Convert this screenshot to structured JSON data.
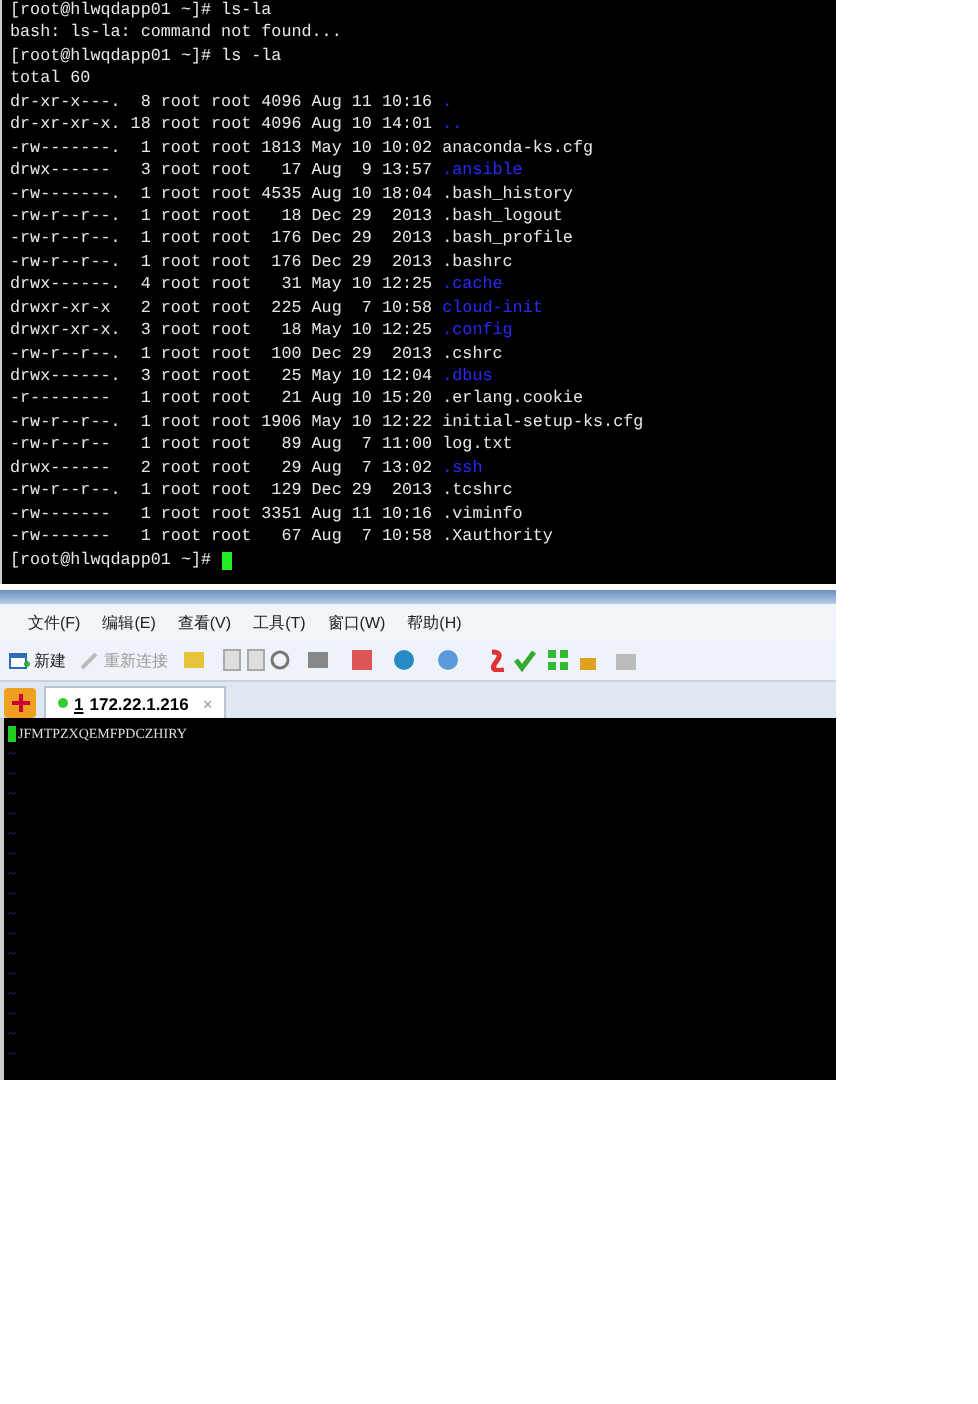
{
  "terminal_top": {
    "lines": [
      {
        "text": "[root@hlwqdapp01 ~]# ls-la"
      },
      {
        "text": "bash: ls-la: command not found..."
      },
      {
        "text": "[root@hlwqdapp01 ~]# ls -la"
      },
      {
        "text": "total 60"
      },
      {
        "text": "dr-xr-x---.  8 root root 4096 Aug 11 10:16 ",
        "name": ".",
        "kind": "dir"
      },
      {
        "text": "dr-xr-xr-x. 18 root root 4096 Aug 10 14:01 ",
        "name": "..",
        "kind": "dir"
      },
      {
        "text": "-rw-------.  1 root root 1813 May 10 10:02 ",
        "name": "anaconda-ks.cfg",
        "kind": "file"
      },
      {
        "text": "drwx------   3 root root   17 Aug  9 13:57 ",
        "name": ".ansible",
        "kind": "dir"
      },
      {
        "text": "-rw-------.  1 root root 4535 Aug 10 18:04 ",
        "name": ".bash_history",
        "kind": "file"
      },
      {
        "text": "-rw-r--r--.  1 root root   18 Dec 29  2013 ",
        "name": ".bash_logout",
        "kind": "file"
      },
      {
        "text": "-rw-r--r--.  1 root root  176 Dec 29  2013 ",
        "name": ".bash_profile",
        "kind": "file"
      },
      {
        "text": "-rw-r--r--.  1 root root  176 Dec 29  2013 ",
        "name": ".bashrc",
        "kind": "file"
      },
      {
        "text": "drwx------.  4 root root   31 May 10 12:25 ",
        "name": ".cache",
        "kind": "dir"
      },
      {
        "text": "drwxr-xr-x   2 root root  225 Aug  7 10:58 ",
        "name": "cloud-init",
        "kind": "dir"
      },
      {
        "text": "drwxr-xr-x.  3 root root   18 May 10 12:25 ",
        "name": ".config",
        "kind": "dir"
      },
      {
        "text": "-rw-r--r--.  1 root root  100 Dec 29  2013 ",
        "name": ".cshrc",
        "kind": "file"
      },
      {
        "text": "drwx------.  3 root root   25 May 10 12:04 ",
        "name": ".dbus",
        "kind": "dir"
      },
      {
        "text": "-r--------   1 root root   21 Aug 10 15:20 ",
        "name": ".erlang.cookie",
        "kind": "file"
      },
      {
        "text": "-rw-r--r--.  1 root root 1906 May 10 12:22 ",
        "name": "initial-setup-ks.cfg",
        "kind": "file"
      },
      {
        "text": "-rw-r--r--   1 root root   89 Aug  7 11:00 ",
        "name": "log.txt",
        "kind": "file"
      },
      {
        "text": "drwx------   2 root root   29 Aug  7 13:02 ",
        "name": ".ssh",
        "kind": "dir"
      },
      {
        "text": "-rw-r--r--.  1 root root  129 Dec 29  2013 ",
        "name": ".tcshrc",
        "kind": "file"
      },
      {
        "text": "-rw-------   1 root root 3351 Aug 11 10:16 ",
        "name": ".viminfo",
        "kind": "file"
      },
      {
        "text": "-rw-------   1 root root   67 Aug  7 10:58 ",
        "name": ".Xauthority",
        "kind": "file"
      }
    ],
    "prompt": "[root@hlwqdapp01 ~]# "
  },
  "menu": [
    "文件(F)",
    "编辑(E)",
    "查看(V)",
    "工具(T)",
    "窗口(W)",
    "帮助(H)"
  ],
  "toolbar": [
    {
      "kind": "new",
      "label": "新建",
      "disabled": false
    },
    {
      "kind": "reconnect",
      "label": "重新连接",
      "disabled": true
    }
  ],
  "tabs": [
    {
      "number": "1",
      "label": "172.22.1.216",
      "selected": true,
      "close": "×"
    }
  ],
  "terminal_bottom": {
    "first_line": "JFMTPZXQEMFPDCZHIRY",
    "tildes": [
      "~",
      "~",
      "~",
      "~",
      "~",
      "~",
      "~",
      "~",
      "~",
      "~",
      "~",
      "~",
      "~",
      "~",
      "~",
      "~"
    ]
  }
}
